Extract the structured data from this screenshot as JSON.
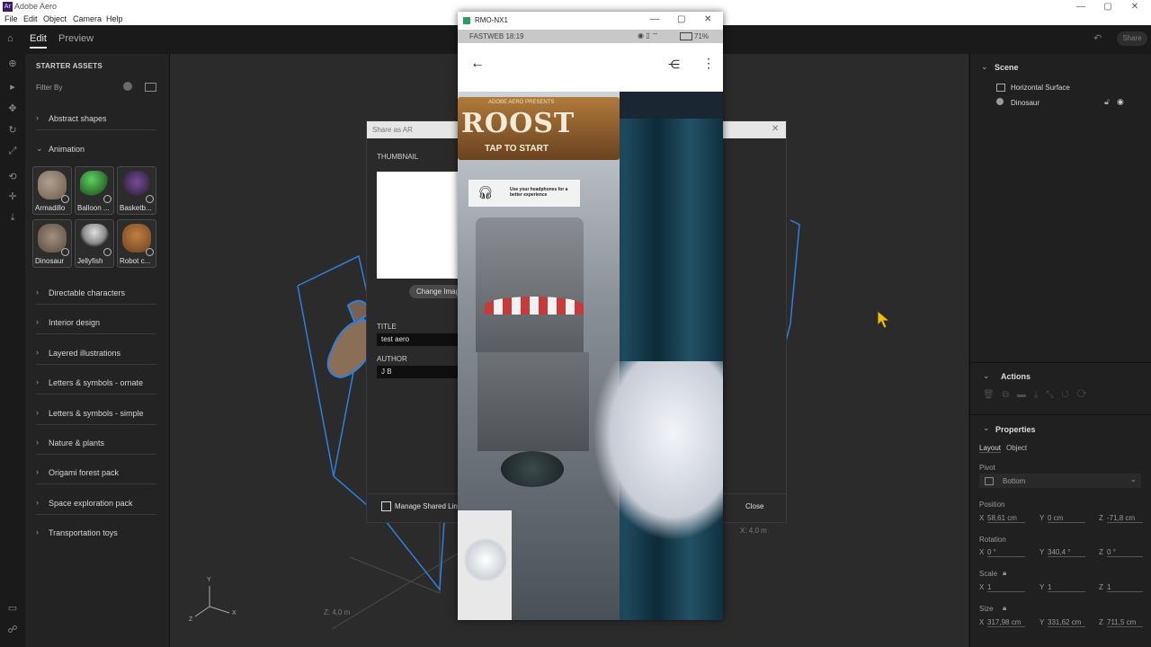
{
  "app": {
    "title": "Adobe Aero",
    "icon_text": "Ar",
    "menu": [
      "File",
      "Edit",
      "Object",
      "Camera",
      "Help"
    ],
    "window_controls": [
      "—",
      "▢",
      "✕"
    ]
  },
  "topbar": {
    "tabs": [
      "Edit",
      "Preview"
    ],
    "active_tab": "Edit",
    "share_label": "Share"
  },
  "assets": {
    "header": "STARTER ASSETS",
    "filter_label": "Filter By",
    "categories_top": [
      "Abstract shapes"
    ],
    "open_category": "Animation",
    "animation_items": [
      {
        "name": "Armadillo",
        "color": "#8a7a6a"
      },
      {
        "name": "Balloon ...",
        "color": "#3c9a3c"
      },
      {
        "name": "Basketb...",
        "color": "#5a3a7a"
      },
      {
        "name": "Dinosaur",
        "color": "#8a7a6e"
      },
      {
        "name": "Jellyfish",
        "color": "#aaaaaa"
      },
      {
        "name": "Robot c...",
        "color": "#9a6a3a"
      }
    ],
    "categories_bottom": [
      "Directable characters",
      "Interior design",
      "Layered illustrations",
      "Letters & symbols - ornate",
      "Letters & symbols - simple",
      "Nature & plants",
      "Origami forest pack",
      "Space exploration pack",
      "Transportation toys"
    ]
  },
  "viewport": {
    "axis_labels": {
      "y": "Y",
      "x": "X",
      "z": "Z"
    },
    "dim_left": "Z:  4,0 m",
    "dim_right": "X:  4,0 m"
  },
  "share_dialog": {
    "title": "Share as AR",
    "thumbnail_label": "THUMBNAIL",
    "change_image": "Change Image",
    "title_label": "TITLE",
    "title_value": "test aero",
    "author_label": "AUTHOR",
    "author_value": "J B",
    "manage_links": "Manage Shared Links",
    "close_button": "Close"
  },
  "phone_window": {
    "title": "RMO-NX1",
    "carrier_time": "FASTWEB 18:19",
    "battery": "71%",
    "ar_banner_brand": "ADOBE AERO PRESENTS",
    "ar_banner_title": "ROOST",
    "ar_tap": "TAP TO START",
    "ar_headphones": "Use your headphones for a better experience"
  },
  "scene": {
    "header": "Scene",
    "items": [
      "Horizontal Surface",
      "Dinosaur"
    ]
  },
  "actions": {
    "header": "Actions"
  },
  "properties": {
    "header": "Properties",
    "tabs": [
      "Layout",
      "Object"
    ],
    "pivot_label": "Pivot",
    "pivot_value": "Bottom",
    "position_label": "Position",
    "position": {
      "x": "58,61 cm",
      "y": "0 cm",
      "z": "-71,8 cm"
    },
    "rotation_label": "Rotation",
    "rotation": {
      "x": "0 °",
      "y": "340,4 °",
      "z": "0 °"
    },
    "scale_label": "Scale",
    "scale": {
      "x": "1",
      "y": "1",
      "z": "1"
    },
    "size_label": "Size",
    "size": {
      "x": "317,98 cm",
      "y": "331,62 cm",
      "z": "711,5 cm"
    }
  },
  "colors": {
    "selection_blue": "#2f7fe0",
    "panel_bg": "#232323",
    "viewport_bg": "#2b2b2b"
  }
}
